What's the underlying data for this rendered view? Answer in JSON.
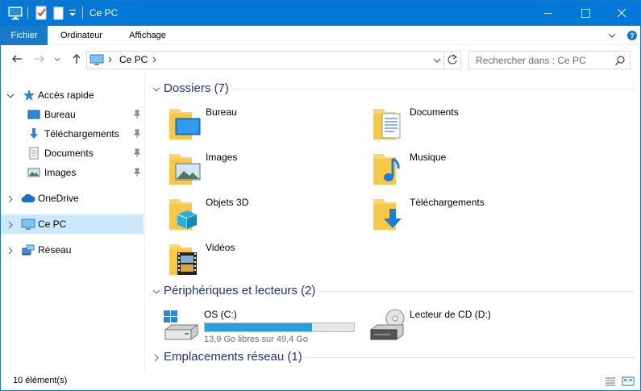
{
  "window": {
    "title": "Ce PC",
    "colors": {
      "titlebar": "#0078d7",
      "selection": "#cce8ff",
      "group_title": "#1e3287",
      "progress": "#26a0da"
    }
  },
  "titlebar": {
    "icons": [
      "computer-icon",
      "properties-check-icon",
      "new-folder-icon",
      "dropdown-icon"
    ],
    "controls": [
      "minimize",
      "maximize",
      "close"
    ]
  },
  "ribbon": {
    "tabs": [
      {
        "label": "Fichier",
        "active": true
      },
      {
        "label": "Ordinateur",
        "active": false
      },
      {
        "label": "Affichage",
        "active": false
      }
    ]
  },
  "address": {
    "crumbs": [
      "Ce PC"
    ],
    "search_placeholder": "Rechercher dans : Ce PC"
  },
  "sidebar": {
    "quick_access": "Accès rapide",
    "pinned": [
      {
        "label": "Bureau",
        "icon": "desktop-icon"
      },
      {
        "label": "Téléchargements",
        "icon": "download-icon"
      },
      {
        "label": "Documents",
        "icon": "document-icon"
      },
      {
        "label": "Images",
        "icon": "pictures-icon"
      }
    ],
    "onedrive": "OneDrive",
    "this_pc": "Ce PC",
    "network": "Réseau"
  },
  "groups": {
    "folders": "Dossiers (7)",
    "devices": "Périphériques et lecteurs (2)",
    "network": "Emplacements réseau (1)"
  },
  "folders": [
    {
      "label": "Bureau",
      "icon": "desktop-folder-icon"
    },
    {
      "label": "Documents",
      "icon": "documents-folder-icon"
    },
    {
      "label": "Images",
      "icon": "pictures-folder-icon"
    },
    {
      "label": "Musique",
      "icon": "music-folder-icon"
    },
    {
      "label": "Objets 3D",
      "icon": "objects-3d-folder-icon"
    },
    {
      "label": "Téléchargements",
      "icon": "downloads-folder-icon"
    },
    {
      "label": "Vidéos",
      "icon": "videos-folder-icon"
    }
  ],
  "drives": [
    {
      "label": "OS (C:)",
      "free": "13,9 Go libres sur 49,4 Go",
      "used_fraction": 0.72,
      "icon": "windows-drive-icon"
    },
    {
      "label": "Lecteur de CD (D:)",
      "icon": "cd-drive-icon"
    }
  ],
  "status": {
    "count": "10 élément(s)"
  }
}
